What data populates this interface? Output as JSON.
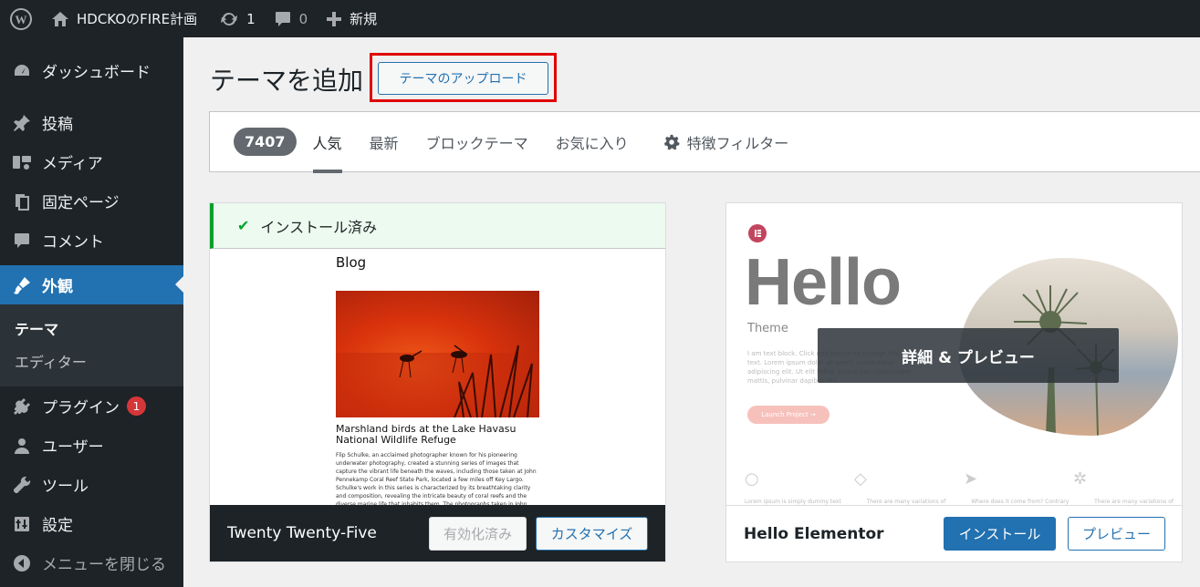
{
  "adminbar": {
    "site_name": "HDCKOのFIRE計画",
    "updates_count": "1",
    "comments_count": "0",
    "new_label": "新規"
  },
  "sidebar": {
    "items": [
      {
        "label": "ダッシュボード",
        "icon": "dashboard-icon"
      },
      {
        "label": "投稿",
        "icon": "pin-icon"
      },
      {
        "label": "メディア",
        "icon": "media-icon"
      },
      {
        "label": "固定ページ",
        "icon": "pages-icon"
      },
      {
        "label": "コメント",
        "icon": "comment-icon"
      },
      {
        "label": "外観",
        "icon": "appearance-icon"
      },
      {
        "label": "プラグイン",
        "icon": "plugin-icon",
        "badge": "1"
      },
      {
        "label": "ユーザー",
        "icon": "user-icon"
      },
      {
        "label": "ツール",
        "icon": "wrench-icon"
      },
      {
        "label": "設定",
        "icon": "settings-icon"
      },
      {
        "label": "メニューを閉じる",
        "icon": "collapse-icon"
      }
    ],
    "submenu": [
      "テーマ",
      "エディター"
    ]
  },
  "page": {
    "title": "テーマを追加",
    "upload_button": "テーマのアップロード"
  },
  "filters": {
    "count": "7407",
    "tabs": [
      "人気",
      "最新",
      "ブロックテーマ",
      "お気に入り"
    ],
    "active_tab": "人気",
    "feature_filter": "特徴フィルター"
  },
  "themes": [
    {
      "name": "Twenty Twenty-Five",
      "installed_label": "インストール済み",
      "preview": {
        "blog_title": "Blog",
        "post_title": "Marshland birds at the Lake Havasu National Wildlife Refuge",
        "post_body": "Flip Schulke, an acclaimed photographer known for his pioneering underwater photography, created a stunning series of images that capture the vibrant life beneath the waves, including those taken at John Pennekamp Coral Reef State Park, located a few miles off Key Largo. Schulke's work in this series is characterized by its breathtaking clarity and composition, revealing the intricate beauty of coral reefs and the diverse marine life that inhabits them. The photographs taken in John Pennekamp Coral Reef State Park are particularly notable for their vivid depiction of the underwater ecosystem."
      },
      "buttons": {
        "activated": "有効化済み",
        "customize": "カスタマイズ"
      }
    },
    {
      "name": "Hello Elementor",
      "preview": {
        "headline": "Hello",
        "subtitle": "Theme",
        "body": "I am text block. Click edit button to change this text. Lorem ipsum dolor sit amet, consectetur adipiscing elit. Ut elit tellus, luctus nec ullamcorper mattis, pulvinar dapibus leo.",
        "cta": "Launch Project →",
        "captions": [
          "Lorem ipsum is simply dummy text",
          "There are many variations of",
          "Where does it come from? Contrary",
          "There are many variations of"
        ]
      },
      "overlay": "詳細 & プレビュー",
      "buttons": {
        "install": "インストール",
        "preview": "プレビュー"
      }
    }
  ],
  "colors": {
    "admin_dark": "#1d2327",
    "accent_blue": "#2271b1",
    "installed_green": "#00a32a",
    "highlight_red": "#e00000"
  }
}
